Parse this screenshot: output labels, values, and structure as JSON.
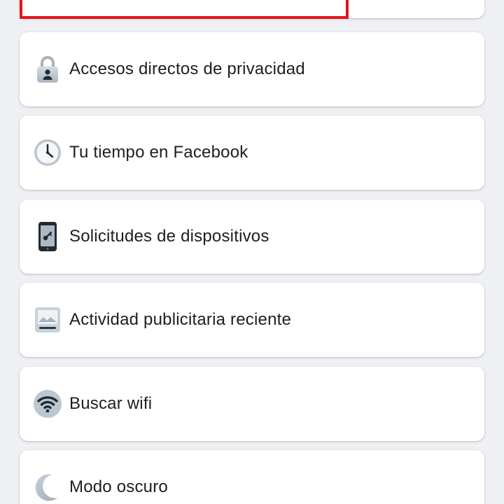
{
  "menu": {
    "items": [
      {
        "label": "Accesos directos de privacidad",
        "icon": "lock-icon"
      },
      {
        "label": "Tu tiempo en Facebook",
        "icon": "clock-icon"
      },
      {
        "label": "Solicitudes de dispositivos",
        "icon": "phone-key-icon"
      },
      {
        "label": "Actividad publicitaria reciente",
        "icon": "ad-activity-icon"
      },
      {
        "label": "Buscar wifi",
        "icon": "wifi-icon"
      },
      {
        "label": "Modo oscuro",
        "icon": "moon-icon"
      }
    ]
  },
  "colors": {
    "background": "#eef0f4",
    "card": "#ffffff",
    "text": "#1c1e21",
    "highlight": "#e3151a"
  }
}
